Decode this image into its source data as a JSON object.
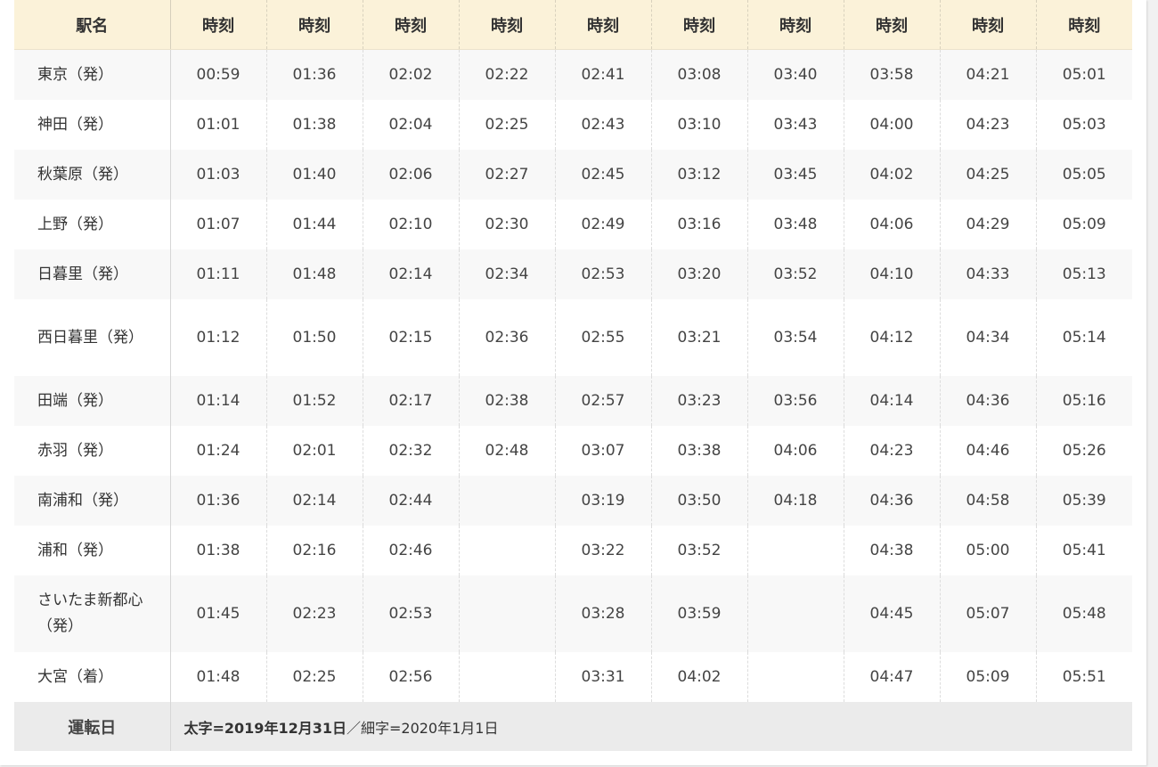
{
  "header": {
    "station_label": "駅名",
    "time_labels": [
      "時刻",
      "時刻",
      "時刻",
      "時刻",
      "時刻",
      "時刻",
      "時刻",
      "時刻",
      "時刻",
      "時刻"
    ]
  },
  "rows": [
    {
      "station": "東京（発）",
      "times": [
        "00:59",
        "01:36",
        "02:02",
        "02:22",
        "02:41",
        "03:08",
        "03:40",
        "03:58",
        "04:21",
        "05:01"
      ]
    },
    {
      "station": "神田（発）",
      "times": [
        "01:01",
        "01:38",
        "02:04",
        "02:25",
        "02:43",
        "03:10",
        "03:43",
        "04:00",
        "04:23",
        "05:03"
      ]
    },
    {
      "station": "秋葉原（発）",
      "times": [
        "01:03",
        "01:40",
        "02:06",
        "02:27",
        "02:45",
        "03:12",
        "03:45",
        "04:02",
        "04:25",
        "05:05"
      ]
    },
    {
      "station": "上野（発）",
      "times": [
        "01:07",
        "01:44",
        "02:10",
        "02:30",
        "02:49",
        "03:16",
        "03:48",
        "04:06",
        "04:29",
        "05:09"
      ]
    },
    {
      "station": "日暮里（発）",
      "times": [
        "01:11",
        "01:48",
        "02:14",
        "02:34",
        "02:53",
        "03:20",
        "03:52",
        "04:10",
        "04:33",
        "05:13"
      ]
    },
    {
      "station": "西日暮里（発）",
      "times": [
        "01:12",
        "01:50",
        "02:15",
        "02:36",
        "02:55",
        "03:21",
        "03:54",
        "04:12",
        "04:34",
        "05:14"
      ]
    },
    {
      "station": "田端（発）",
      "times": [
        "01:14",
        "01:52",
        "02:17",
        "02:38",
        "02:57",
        "03:23",
        "03:56",
        "04:14",
        "04:36",
        "05:16"
      ]
    },
    {
      "station": "赤羽（発）",
      "times": [
        "01:24",
        "02:01",
        "02:32",
        "02:48",
        "03:07",
        "03:38",
        "04:06",
        "04:23",
        "04:46",
        "05:26"
      ]
    },
    {
      "station": "南浦和（発）",
      "times": [
        "01:36",
        "02:14",
        "02:44",
        "",
        "03:19",
        "03:50",
        "04:18",
        "04:36",
        "04:58",
        "05:39"
      ]
    },
    {
      "station": "浦和（発）",
      "times": [
        "01:38",
        "02:16",
        "02:46",
        "",
        "03:22",
        "03:52",
        "",
        "04:38",
        "05:00",
        "05:41"
      ]
    },
    {
      "station": "さいたま新都心（発）",
      "times": [
        "01:45",
        "02:23",
        "02:53",
        "",
        "03:28",
        "03:59",
        "",
        "04:45",
        "05:07",
        "05:48"
      ]
    },
    {
      "station": "大宮（着）",
      "times": [
        "01:48",
        "02:25",
        "02:56",
        "",
        "03:31",
        "04:02",
        "",
        "04:47",
        "05:09",
        "05:51"
      ]
    }
  ],
  "operation": {
    "label": "運転日",
    "note_bold": "太字=2019年12月31日",
    "note_normal": "／細字=2020年1月1日"
  }
}
